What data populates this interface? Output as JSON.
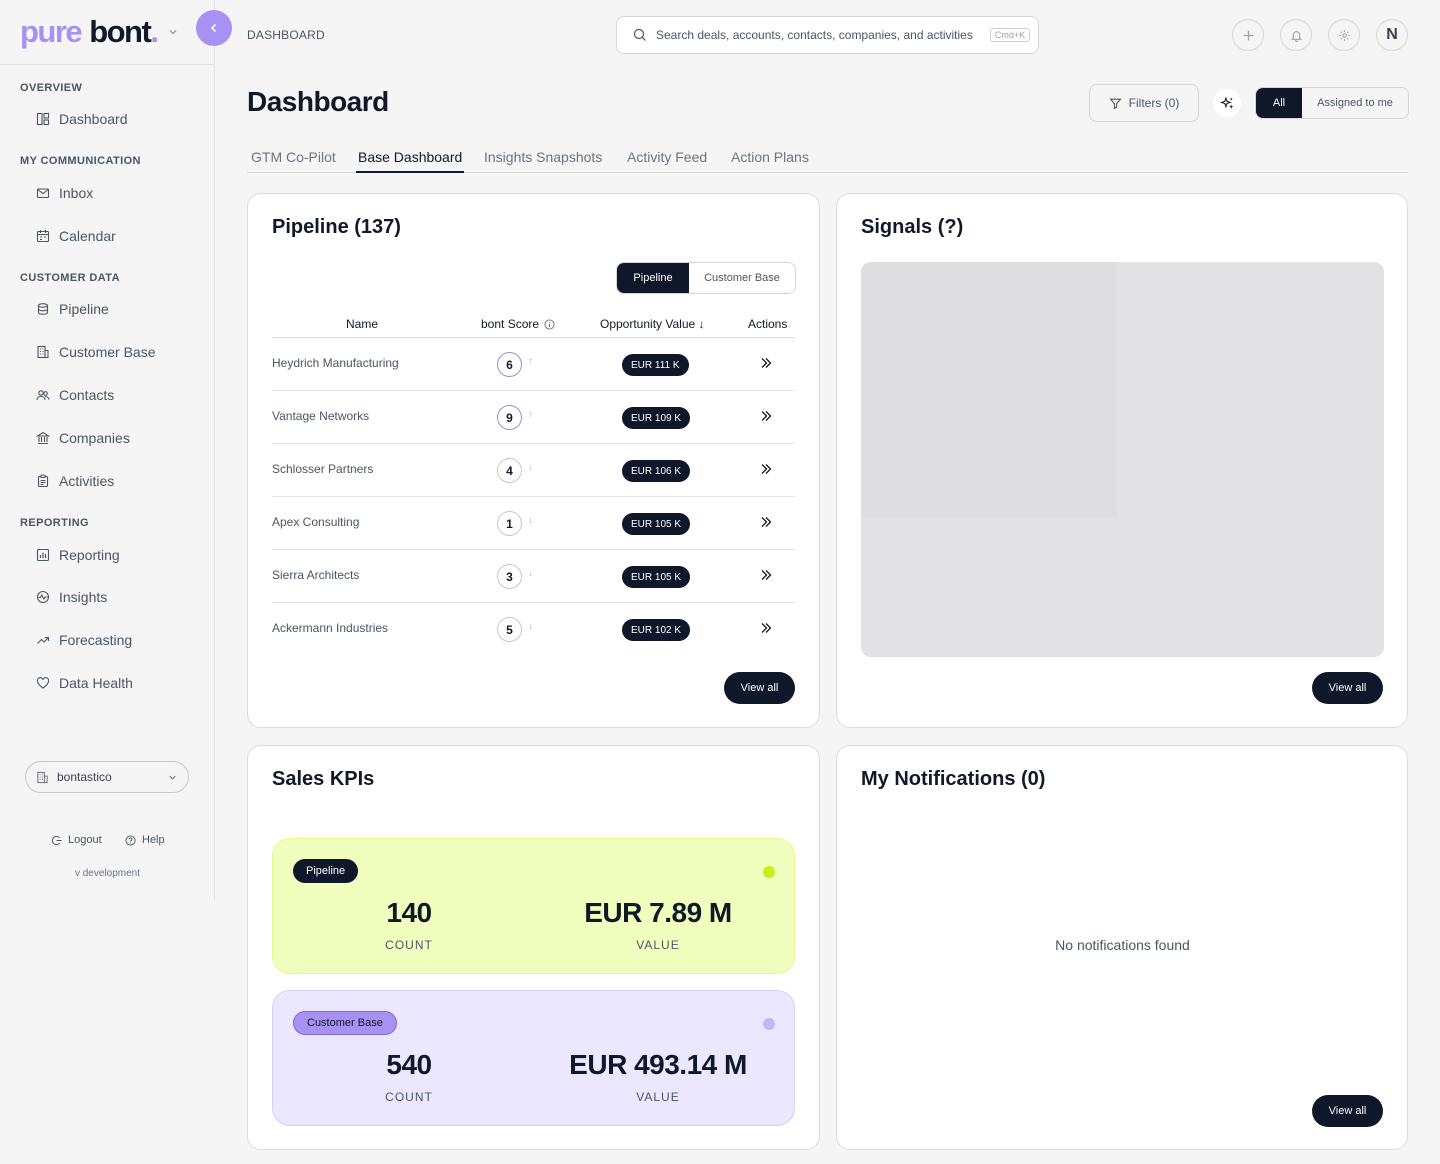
{
  "brand": {
    "part1": "pure",
    "part2": "bont",
    "dot": "."
  },
  "sidebar": {
    "sections": {
      "overview": "OVERVIEW",
      "communication": "MY COMMUNICATION",
      "customer": "CUSTOMER DATA",
      "reporting": "REPORTING"
    },
    "items": {
      "dashboard": "Dashboard",
      "inbox": "Inbox",
      "calendar": "Calendar",
      "pipeline": "Pipeline",
      "customer_base": "Customer Base",
      "contacts": "Contacts",
      "companies": "Companies",
      "activities": "Activities",
      "reporting": "Reporting",
      "insights": "Insights",
      "forecasting": "Forecasting",
      "data_health": "Data Health"
    },
    "org": "bontastico",
    "logout": "Logout",
    "help": "Help",
    "version": "v development"
  },
  "header": {
    "breadcrumb": "DASHBOARD",
    "search_placeholder": "Search deals, accounts, contacts, companies, and activities",
    "shortcut": "Cmd+K",
    "avatar": "N"
  },
  "page": {
    "title": "Dashboard",
    "filters": "Filters (0)",
    "scope_all": "All",
    "scope_assigned": "Assigned to me"
  },
  "tabs": [
    "GTM Co-Pilot",
    "Base Dashboard",
    "Insights Snapshots",
    "Activity Feed",
    "Action Plans"
  ],
  "pipeline": {
    "title": "Pipeline (137)",
    "toggle_on": "Pipeline",
    "toggle_off": "Customer Base",
    "columns": {
      "name": "Name",
      "score": "bont Score",
      "value": "Opportunity Value ↓",
      "actions": "Actions"
    },
    "rows": [
      {
        "name": "Heydrich Manufacturing",
        "score": "6",
        "trend": "↑",
        "value": "EUR 111 K"
      },
      {
        "name": "Vantage Networks",
        "score": "9",
        "trend": "↑",
        "value": "EUR 109 K"
      },
      {
        "name": "Schlosser Partners",
        "score": "4",
        "trend": "↓",
        "value": "EUR 106 K"
      },
      {
        "name": "Apex Consulting",
        "score": "1",
        "trend": "↓",
        "value": "EUR 105 K"
      },
      {
        "name": "Sierra Architects",
        "score": "3",
        "trend": "↓",
        "value": "EUR 105 K"
      },
      {
        "name": "Ackermann Industries",
        "score": "5",
        "trend": "↓",
        "value": "EUR 102 K"
      }
    ],
    "view_all": "View all"
  },
  "signals": {
    "title": "Signals (?)",
    "view_all": "View all"
  },
  "kpis": {
    "title": "Sales KPIs",
    "pipeline": {
      "badge": "Pipeline",
      "count": "140",
      "count_label": "COUNT",
      "value": "EUR 7.89 M",
      "value_label": "VALUE",
      "dot_color": "#c9ef1a"
    },
    "customer_base": {
      "badge": "Customer Base",
      "count": "540",
      "count_label": "COUNT",
      "value": "EUR 493.14 M",
      "value_label": "VALUE",
      "dot_color": "#c3b8f5"
    }
  },
  "notifications": {
    "title": "My Notifications (0)",
    "empty": "No notifications found",
    "view_all": "View all"
  },
  "colors": {
    "accent": "#a592f2",
    "dark": "#0f172a"
  }
}
